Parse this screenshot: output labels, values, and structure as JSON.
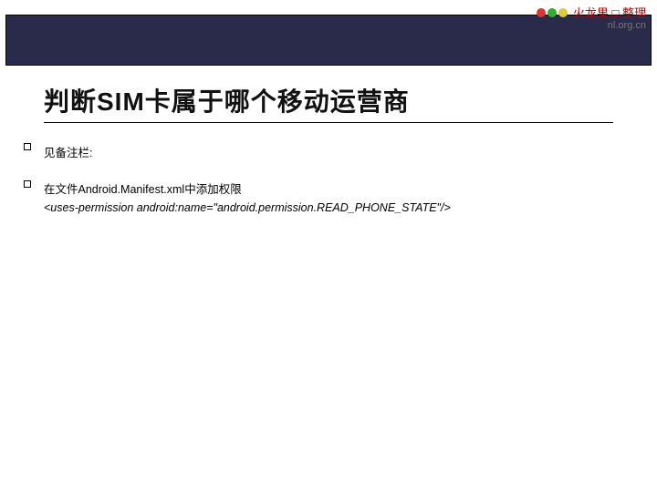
{
  "watermark": {
    "text": "火龙果 □ 整理",
    "url": "nl.org.cn"
  },
  "title": "判断SIM卡属于哪个移动运营商",
  "note_label": "见备注栏:",
  "manifest_line": "在文件Android.Manifest.xml中添加权限",
  "permission_line": "<uses-permission android:name=\"android.permission.READ_PHONE_STATE\"/>"
}
